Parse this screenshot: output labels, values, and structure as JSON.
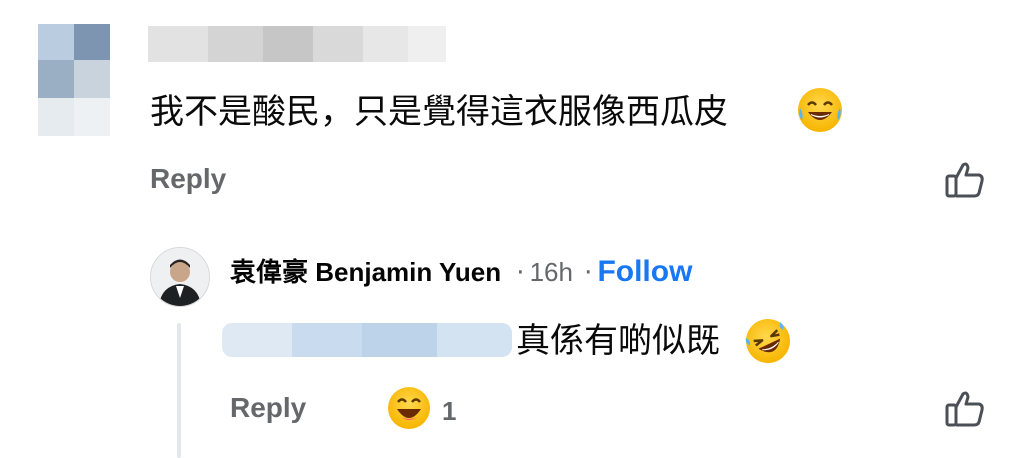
{
  "comment": {
    "text": "我不是酸民，只是覺得這衣服像西瓜皮",
    "emoji": "tears-of-joy-emoji",
    "reply_label": "Reply",
    "like_icon": "thumbs-up-icon"
  },
  "reply": {
    "author": "袁偉豪 Benjamin Yuen",
    "separator": "·",
    "time": "16h",
    "separator2": "·",
    "follow_label": "Follow",
    "text": "真係有啲似既",
    "emoji": "rolling-laughing-emoji",
    "reply_label": "Reply",
    "reaction_icon": "haha-reaction-icon",
    "reaction_count": "1",
    "like_icon": "thumbs-up-icon"
  },
  "colors": {
    "secondary_text": "#65676b",
    "link_blue": "#1877f2",
    "thread_line": "#e4e6eb"
  }
}
